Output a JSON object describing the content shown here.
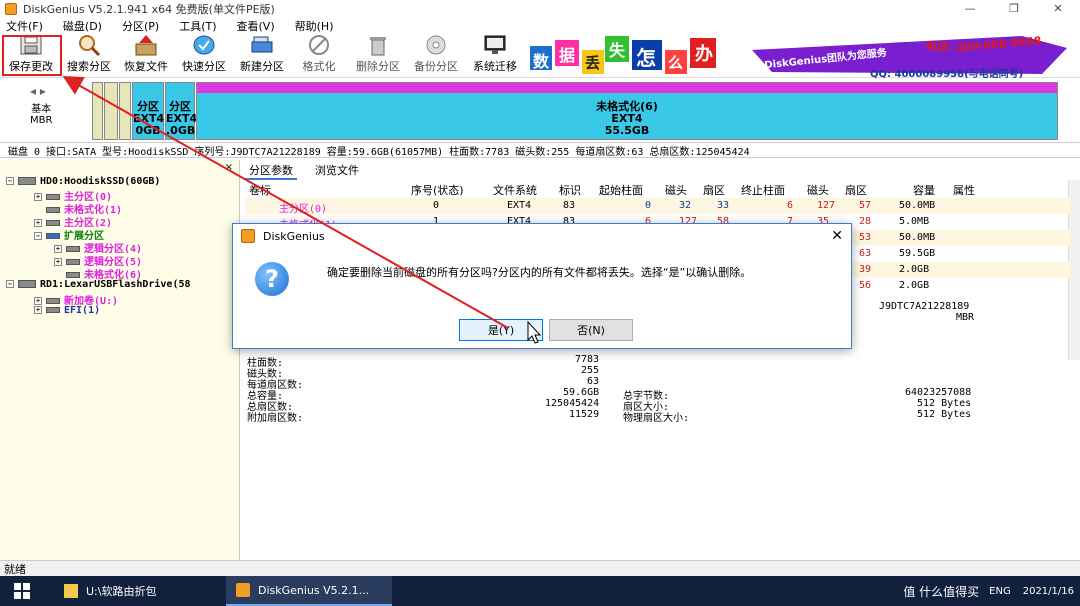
{
  "window": {
    "title": "DiskGenius V5.2.1.941 x64 免费版(单文件PE版)",
    "controls": [
      "—",
      "❐",
      "✕"
    ]
  },
  "menu": [
    "文件(F)",
    "磁盘(D)",
    "分区(P)",
    "工具(T)",
    "查看(V)",
    "帮助(H)"
  ],
  "toolbar": {
    "save": "保存更改",
    "search": "搜索分区",
    "recover": "恢复文件",
    "quick_partition": "快速分区",
    "new_partition": "新建分区",
    "format": "格式化",
    "delete": "删除分区",
    "backup": "备份分区",
    "migrate": "系统迁移"
  },
  "banner": {
    "chars": [
      "数",
      "据",
      "丢",
      "失",
      "怎",
      "么",
      "办"
    ],
    "brand": "DiskGenius团队为您服务",
    "phone": "400-008-9958",
    "phone_prefix": "电话:",
    "qq": "QQ: 4000089958(与电话同号)"
  },
  "diskmap": {
    "nav": "◂ ▸",
    "label_line1": "基本",
    "label_line2": "MBR",
    "seg1": "分区",
    "seg1b": "EXT4",
    "seg1c": "0GB",
    "seg2": "分区",
    "seg2b": "EXT4",
    "seg2c": ".0GB",
    "main_name": "未格式化(6)",
    "main_fs": "EXT4",
    "main_size": "55.5GB"
  },
  "disk_info": "磁盘 0 接口:SATA  型号:HoodiskSSD  序列号:J9DTC7A21228189  容量:59.6GB(61057MB)  柱面数:7783  磁头数:255  每道扇区数:63  总扇区数:125045424",
  "tree": {
    "close": "×",
    "items": [
      {
        "label": "HD0:HoodiskSSD(60GB)",
        "color": "#000000"
      },
      {
        "label": "主分区(0)",
        "color": "#e020e0"
      },
      {
        "label": "未格式化(1)",
        "color": "#e020e0"
      },
      {
        "label": "主分区(2)",
        "color": "#e020e0"
      },
      {
        "label": "扩展分区",
        "color": "#108010"
      },
      {
        "label": "逻辑分区(4)",
        "color": "#e020e0"
      },
      {
        "label": "逻辑分区(5)",
        "color": "#e020e0"
      },
      {
        "label": "未格式化(6)",
        "color": "#e020e0"
      },
      {
        "label": "RD1:LexarUSBFlashDrive(58",
        "color": "#000000"
      },
      {
        "label": "新加卷(U:)",
        "color": "#e020e0"
      },
      {
        "label": "EFI(1)",
        "color": "#1a3a9a"
      }
    ]
  },
  "tabs": [
    "分区参数",
    "浏览文件"
  ],
  "table": {
    "headers": [
      "卷标",
      "序号(状态)",
      "文件系统",
      "标识",
      "起始柱面",
      "磁头",
      "扇区",
      "终止柱面",
      "磁头",
      "扇区",
      "容量",
      "属性"
    ],
    "rows": [
      [
        "主分区(0)",
        "0",
        "EXT4",
        "83",
        "0",
        "32",
        "33",
        "6",
        "127",
        "57",
        "50.0MB"
      ],
      [
        "未格式化(1)",
        "1",
        "EXT4",
        "83",
        "6",
        "127",
        "58",
        "7",
        "35",
        "28",
        "5.0MB"
      ],
      [
        "",
        "",
        "",
        "",
        "",
        "",
        "",
        "",
        "",
        "53",
        "50.0MB"
      ],
      [
        "",
        "",
        "",
        "",
        "",
        "",
        "",
        "",
        "",
        "63",
        "59.5GB"
      ],
      [
        "",
        "",
        "",
        "",
        "",
        "",
        "",
        "",
        "",
        "39",
        "2.0GB"
      ],
      [
        "",
        "",
        "",
        "",
        "",
        "",
        "",
        "",
        "",
        "56",
        "2.0GB"
      ]
    ]
  },
  "side_info": {
    "serial": "J9DTC7A21228189",
    "type": "MBR"
  },
  "stats_left": [
    {
      "label": "柱面数:",
      "value": "7783"
    },
    {
      "label": "磁头数:",
      "value": "255"
    },
    {
      "label": "每道扇区数:",
      "value": "63"
    },
    {
      "label": "总容量:",
      "value": "59.6GB"
    },
    {
      "label": "总扇区数:",
      "value": "125045424"
    },
    {
      "label": "附加扇区数:",
      "value": "11529"
    }
  ],
  "stats_right": [
    {
      "label": "总字节数:",
      "value": "64023257088"
    },
    {
      "label": "扇区大小:",
      "value": "512 Bytes"
    },
    {
      "label": "物理扇区大小:",
      "value": "512 Bytes"
    }
  ],
  "status": "就绪",
  "dialog": {
    "title": "DiskGenius",
    "close": "✕",
    "message": "确定要删除当前磁盘的所有分区吗?分区内的所有文件都将丢失。选择“是”以确认删除。",
    "yes": "是(Y)",
    "no": "否(N)"
  },
  "taskbar": {
    "task1": "U:\\软路由折包",
    "task2": "DiskGenius V5.2.1...",
    "lang": "ENG",
    "date": "2021/1/16",
    "watermark": "值 什么值得买"
  },
  "colors": {
    "partition_pink": "#e020e0",
    "partition_cyan": "#3ac8e8",
    "highlight_red": "#e02020",
    "taskbar": "#11203d"
  }
}
